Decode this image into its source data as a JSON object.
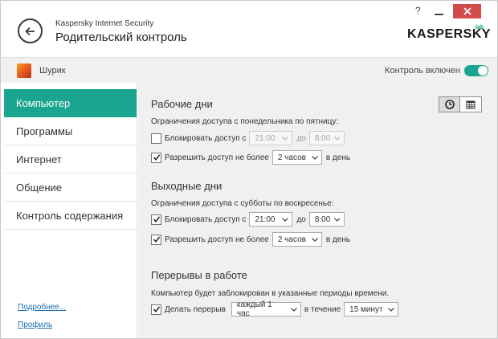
{
  "window": {
    "app_name": "Kaspersky Internet Security",
    "page_title": "Родительский контроль",
    "help_label": "?",
    "brand_text": "KASPERSKY",
    "brand_sub": "lab"
  },
  "userbar": {
    "user_name": "Шурик",
    "control_label": "Контроль включен",
    "control_enabled": true
  },
  "sidebar": {
    "items": [
      {
        "label": "Компьютер",
        "active": true
      },
      {
        "label": "Программы",
        "active": false
      },
      {
        "label": "Интернет",
        "active": false
      },
      {
        "label": "Общение",
        "active": false
      },
      {
        "label": "Контроль содержания",
        "active": false
      }
    ],
    "more_link": "Подробнее...",
    "profile_link": "Профиль"
  },
  "workdays": {
    "title": "Рабочие дни",
    "description": "Ограничения доступа с понедельника по пятницу:",
    "block": {
      "label": "Блокировать доступ с",
      "checked": false,
      "from": "21:00",
      "to_label": "до",
      "to": "8:00"
    },
    "allow": {
      "label": "Разрешить доступ не более",
      "checked": true,
      "value": "2 часов",
      "suffix": "в день"
    }
  },
  "weekends": {
    "title": "Выходные дни",
    "description": "Ограничения доступа с субботы по воскресенье:",
    "block": {
      "label": "Блокировать доступ с",
      "checked": true,
      "from": "21:00",
      "to_label": "до",
      "to": "8:00"
    },
    "allow": {
      "label": "Разрешить доступ не более",
      "checked": true,
      "value": "2 часов",
      "suffix": "в день"
    }
  },
  "breaks": {
    "title": "Перерывы в работе",
    "description": "Компьютер будет заблокирован в указанные периоды времени.",
    "break": {
      "label": "Делать перерыв",
      "checked": true,
      "interval": "каждый 1 час",
      "during_label": "в течение",
      "duration": "15 минут"
    }
  },
  "view_toggle": {
    "active": "clock-icon"
  },
  "colors": {
    "accent": "#19a58f",
    "close": "#d24b4b"
  }
}
